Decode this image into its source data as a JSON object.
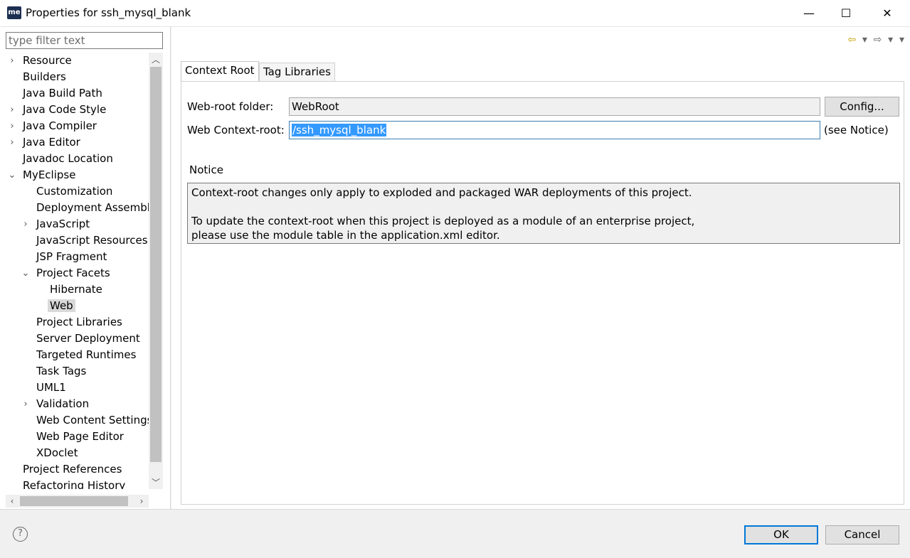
{
  "window": {
    "app_icon": "me",
    "title": "Properties for ssh_mysql_blank",
    "minimize": "—",
    "maximize": "☐",
    "close": "✕"
  },
  "sidebar": {
    "filter_placeholder": "type filter text",
    "items": [
      {
        "label": "Resource",
        "level": 0,
        "toggle": "collapsed"
      },
      {
        "label": "Builders",
        "level": 0,
        "toggle": "none"
      },
      {
        "label": "Java Build Path",
        "level": 0,
        "toggle": "none"
      },
      {
        "label": "Java Code Style",
        "level": 0,
        "toggle": "collapsed"
      },
      {
        "label": "Java Compiler",
        "level": 0,
        "toggle": "collapsed"
      },
      {
        "label": "Java Editor",
        "level": 0,
        "toggle": "collapsed"
      },
      {
        "label": "Javadoc Location",
        "level": 0,
        "toggle": "none"
      },
      {
        "label": "MyEclipse",
        "level": 0,
        "toggle": "expanded"
      },
      {
        "label": "Customization",
        "level": 1,
        "toggle": "none"
      },
      {
        "label": "Deployment Assembly",
        "level": 1,
        "toggle": "none"
      },
      {
        "label": "JavaScript",
        "level": 1,
        "toggle": "collapsed"
      },
      {
        "label": "JavaScript Resources",
        "level": 1,
        "toggle": "none"
      },
      {
        "label": "JSP Fragment",
        "level": 1,
        "toggle": "none"
      },
      {
        "label": "Project Facets",
        "level": 1,
        "toggle": "expanded"
      },
      {
        "label": "Hibernate",
        "level": 2,
        "toggle": "none"
      },
      {
        "label": "Web",
        "level": 2,
        "toggle": "none",
        "selected": true
      },
      {
        "label": "Project Libraries",
        "level": 1,
        "toggle": "none"
      },
      {
        "label": "Server Deployment",
        "level": 1,
        "toggle": "none"
      },
      {
        "label": "Targeted Runtimes",
        "level": 1,
        "toggle": "none"
      },
      {
        "label": "Task Tags",
        "level": 1,
        "toggle": "none"
      },
      {
        "label": "UML1",
        "level": 1,
        "toggle": "none"
      },
      {
        "label": "Validation",
        "level": 1,
        "toggle": "collapsed"
      },
      {
        "label": "Web Content Settings",
        "level": 1,
        "toggle": "none"
      },
      {
        "label": "Web Page Editor",
        "level": 1,
        "toggle": "none"
      },
      {
        "label": "XDoclet",
        "level": 1,
        "toggle": "none"
      },
      {
        "label": "Project References",
        "level": 0,
        "toggle": "none"
      },
      {
        "label": "Refactoring History",
        "level": 0,
        "toggle": "none"
      }
    ]
  },
  "tabs": [
    {
      "label": "Context Root",
      "active": true
    },
    {
      "label": "Tag Libraries",
      "active": false
    }
  ],
  "form": {
    "web_root_label": "Web-root folder:",
    "web_root_value": "WebRoot",
    "config_button": "Config...",
    "context_root_label": "Web Context-root:",
    "context_root_value": "/ssh_mysql_blank",
    "see_notice": "(see Notice)",
    "notice_title": "Notice",
    "notice_line1": "Context-root changes only apply to exploded and packaged WAR deployments of this project.",
    "notice_line2": "To update the context-root when this project is deployed as a module of an enterprise project,",
    "notice_line3": "please use the module table in the application.xml editor."
  },
  "footer": {
    "help_icon": "?",
    "ok": "OK",
    "cancel": "Cancel"
  },
  "icons": {
    "back": "⇦",
    "forward": "⇨",
    "dropdown": "▾",
    "expanded": "⌄",
    "collapsed": "›"
  }
}
